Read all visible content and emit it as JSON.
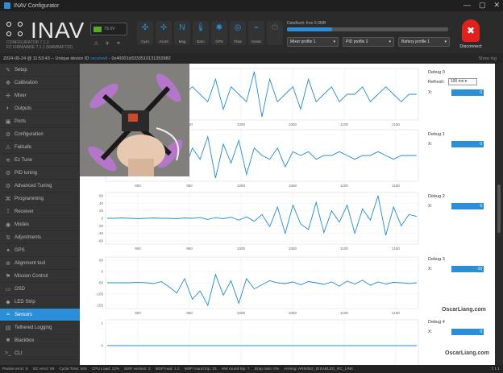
{
  "window": {
    "title": "INAV Configurator",
    "minimize": "—",
    "maximize": "▢",
    "close": "✕"
  },
  "brand": {
    "name": "INAV",
    "config_line": "CONFIGURATOR  7.1.1",
    "fw_line": "FC FIRMWARE  7.1.1 (MAMBAF722)"
  },
  "battery": {
    "label": "7S 0V",
    "charge_fraction": 0.25
  },
  "sensors": [
    {
      "label": "Gyro",
      "icon": "gyro-icon",
      "glyph": "✣",
      "active": true
    },
    {
      "label": "Accel",
      "icon": "accel-icon",
      "glyph": "✢",
      "active": true
    },
    {
      "label": "Mag",
      "icon": "mag-icon",
      "glyph": "N",
      "active": true
    },
    {
      "label": "Baro",
      "icon": "baro-icon",
      "glyph": "🌡",
      "active": true
    },
    {
      "label": "GPS",
      "icon": "gps-icon",
      "glyph": "✱",
      "active": true
    },
    {
      "label": "Flow",
      "icon": "flow-icon",
      "glyph": "◎",
      "active": true
    },
    {
      "label": "Sonar",
      "icon": "sonar-icon",
      "glyph": "⌁",
      "active": true
    },
    {
      "label": "",
      "icon": "power-icon",
      "glyph": "⏻",
      "active": false
    }
  ],
  "dataflash": {
    "label": "Dataflash: free 9.9MB",
    "used_fraction": 0.28
  },
  "profiles": {
    "mixer": "Mixer profile 1",
    "pid": "PID profile 2",
    "battery": "Battery profile 1"
  },
  "disconnect": {
    "label": "Disconnect"
  },
  "status": {
    "timestamp": "2024-06-24 @ 11:53:43 -- Unique device ID",
    "received": "received",
    "uid": "- 0x40001d3333510131353982",
    "show_log": "Show log"
  },
  "sidebar": [
    {
      "label": "Setup",
      "icon": "wrench-icon",
      "glyph": "✎"
    },
    {
      "label": "Calibration",
      "icon": "calibration-icon",
      "glyph": "✥"
    },
    {
      "label": "Mixer",
      "icon": "mixer-icon",
      "glyph": "✢"
    },
    {
      "label": "Outputs",
      "icon": "outputs-icon",
      "glyph": "◐"
    },
    {
      "label": "Ports",
      "icon": "ports-icon",
      "glyph": "▣"
    },
    {
      "label": "Configuration",
      "icon": "config-icon",
      "glyph": "⚙"
    },
    {
      "label": "Failsafe",
      "icon": "failsafe-icon",
      "glyph": "⚠"
    },
    {
      "label": "Ez Tune",
      "icon": "eztune-icon",
      "glyph": "≋"
    },
    {
      "label": "PID tuning",
      "icon": "pid-icon",
      "glyph": "⚙"
    },
    {
      "label": "Advanced Tuning",
      "icon": "advanced-icon",
      "glyph": "⚙"
    },
    {
      "label": "Programming",
      "icon": "programming-icon",
      "glyph": "⌘"
    },
    {
      "label": "Receiver",
      "icon": "receiver-icon",
      "glyph": "⟟"
    },
    {
      "label": "Modes",
      "icon": "modes-icon",
      "glyph": "◉"
    },
    {
      "label": "Adjustments",
      "icon": "adjustments-icon",
      "glyph": "⇅"
    },
    {
      "label": "GPS",
      "icon": "gps-nav-icon",
      "glyph": "✦"
    },
    {
      "label": "Alignment tool",
      "icon": "alignment-icon",
      "glyph": "⊕"
    },
    {
      "label": "Mission Control",
      "icon": "mission-icon",
      "glyph": "⚑"
    },
    {
      "label": "OSD",
      "icon": "osd-icon",
      "glyph": "▭"
    },
    {
      "label": "LED Strip",
      "icon": "led-icon",
      "glyph": "◆"
    },
    {
      "label": "Sensors",
      "icon": "sensors-icon",
      "glyph": "≈",
      "active": true
    },
    {
      "label": "Tethered Logging",
      "icon": "tethered-icon",
      "glyph": "▤"
    },
    {
      "label": "Blackbox",
      "icon": "blackbox-icon",
      "glyph": "■"
    },
    {
      "label": "CLI",
      "icon": "cli-icon",
      "glyph": ">_"
    }
  ],
  "debug_panel": {
    "refresh_label": "Refresh:",
    "refresh_value": "100 ms",
    "axis_label": "X:",
    "items": [
      {
        "title": "Debug 0",
        "value": "0"
      },
      {
        "title": "Debug 1",
        "value": "0"
      },
      {
        "title": "Debug 2",
        "value": "6"
      },
      {
        "title": "Debug 3",
        "value": "-10"
      },
      {
        "title": "Debug 4",
        "value": "0"
      }
    ]
  },
  "chart_data": [
    {
      "type": "line",
      "name": "Debug 0",
      "x_ticks": [
        "900",
        "950",
        "1000",
        "1050",
        "1100",
        "1150"
      ],
      "y_ticks": [],
      "series": [
        {
          "color": "#1f8bd0",
          "values": [
            0,
            0,
            1,
            0,
            -1,
            0,
            0,
            1,
            0,
            -1,
            0,
            1,
            0,
            -1,
            2,
            -2,
            1,
            0,
            -1,
            3,
            -3,
            2,
            -1,
            0,
            1,
            -2,
            2,
            -1,
            0,
            1,
            -1,
            0,
            0,
            1,
            -1,
            0,
            1,
            0,
            -1,
            0,
            0
          ]
        }
      ]
    },
    {
      "type": "line",
      "name": "Debug 1",
      "x_ticks": [
        "900",
        "950",
        "1000",
        "1050",
        "1100",
        "1150"
      ],
      "y_ticks": [],
      "series": [
        {
          "color": "#1f8bd0",
          "values": [
            0,
            0,
            0,
            1,
            -1,
            0,
            0,
            1,
            -2,
            3,
            -4,
            2,
            -1,
            5,
            -6,
            3,
            -2,
            4,
            -5,
            2,
            0,
            -1,
            2,
            -3,
            1,
            0,
            1,
            -1,
            0,
            0,
            1,
            0,
            -1,
            0,
            0,
            1,
            0,
            -1,
            0,
            0,
            0
          ]
        }
      ]
    },
    {
      "type": "line",
      "name": "Debug 2",
      "x_ticks": [
        "900",
        "950",
        "1000",
        "1050",
        "1100",
        "1150"
      ],
      "y_ticks": [
        "60",
        "40",
        "20",
        "0",
        "-20",
        "-40",
        "-60"
      ],
      "series": [
        {
          "color": "#1f8bd0",
          "values": [
            0,
            0,
            1,
            0,
            -1,
            0,
            1,
            0,
            0,
            -1,
            1,
            0,
            2,
            -3,
            2,
            -1,
            3,
            -5,
            4,
            -8,
            10,
            -22,
            30,
            -40,
            35,
            -15,
            -30,
            42,
            -38,
            20,
            -10,
            35,
            -40,
            25,
            -5,
            60,
            -45,
            30,
            -20,
            10,
            5
          ]
        }
      ]
    },
    {
      "type": "line",
      "name": "Debug 3",
      "x_ticks": [
        "900",
        "950",
        "1000",
        "1050",
        "1100",
        "1150"
      ],
      "y_ticks": [
        "50",
        "0",
        "-50",
        "-100",
        "-150"
      ],
      "series": [
        {
          "color": "#1f8bd0",
          "values": [
            0,
            0,
            0,
            0,
            1,
            0,
            -2,
            3,
            -10,
            -25,
            10,
            -40,
            -20,
            -55,
            20,
            -30,
            5,
            -50,
            10,
            -15,
            -5,
            5,
            0,
            -2,
            2,
            -5,
            3,
            0,
            -4,
            2,
            -8,
            4,
            -3,
            6,
            -6,
            2,
            -3,
            1,
            0,
            -2,
            0
          ]
        }
      ]
    },
    {
      "type": "line",
      "name": "Debug 4",
      "x_ticks": [],
      "y_ticks": [
        "1",
        "0",
        "-1"
      ],
      "series": [
        {
          "color": "#1f8bd0",
          "values": [
            0,
            0,
            0,
            0,
            0,
            0,
            0,
            0,
            0,
            0,
            0,
            0,
            0,
            0,
            0,
            0,
            0,
            0,
            0,
            0,
            0,
            0,
            0,
            0,
            0,
            0,
            0,
            0,
            0,
            0,
            0,
            0,
            0,
            0,
            0,
            0,
            0,
            0,
            0,
            0,
            0
          ]
        }
      ]
    }
  ],
  "footer": {
    "items": [
      "Packet error: 0",
      "I2C error: 50",
      "Cycle Time: 504",
      "CPU Load: 13%",
      "MSP version: 2",
      "MSP load: 1.0",
      "MSP round trip: 25",
      "HW round trip: 7",
      "Drop ratio: 0%",
      "Arming: ARMING_DISABLED_RC_LINK"
    ],
    "version": "7.1.1"
  },
  "watermark": {
    "line1": "OscarLiang.com",
    "line2": "OscarLiang.com"
  }
}
